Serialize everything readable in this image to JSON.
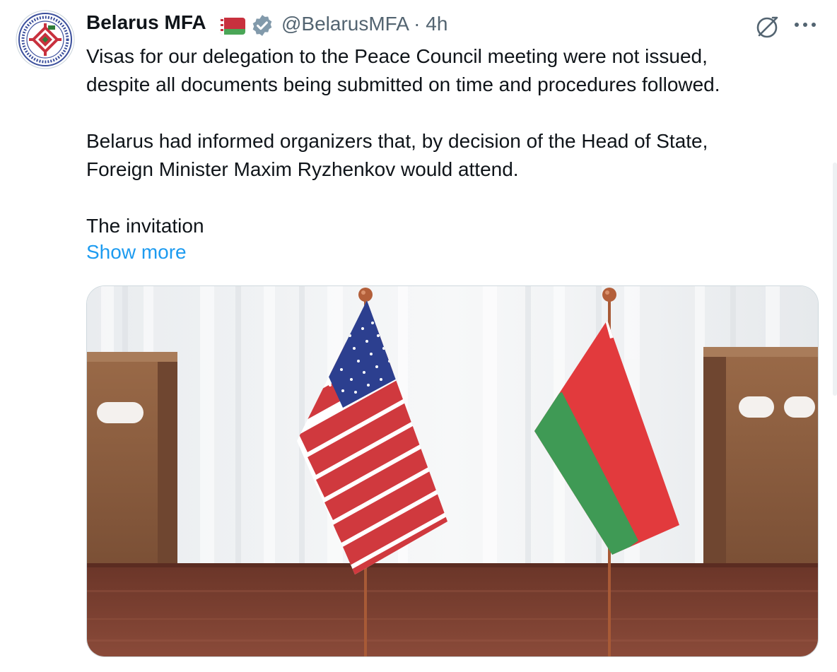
{
  "tweet": {
    "display_name": "Belarus MFA",
    "handle": "@BelarusMFA",
    "separator": "·",
    "time": "4h",
    "paragraphs": [
      "Visas for our delegation to the Peace Council meeting were not issued,\ndespite all documents being submitted on time and procedures followed.",
      "Belarus had informed organizers that, by decision of the Head of State,\nForeign Minister Maxim Ryzhenkov would attend.",
      "The invitation"
    ],
    "show_more": "Show more"
  },
  "icons": {
    "avatar": "belarus-mfa-emblem",
    "flag": "belarus-flag-emoji",
    "verified": "verified-badge-icon",
    "grok": "grok-icon",
    "more": "more-options-icon"
  },
  "colors": {
    "link": "#1d9bf0",
    "muted": "#536471",
    "text": "#0f1419",
    "flag_red": "#c8313e",
    "flag_green": "#4aa657"
  },
  "media": {
    "description_icon": "photo-of-us-and-belarus-table-flags"
  }
}
